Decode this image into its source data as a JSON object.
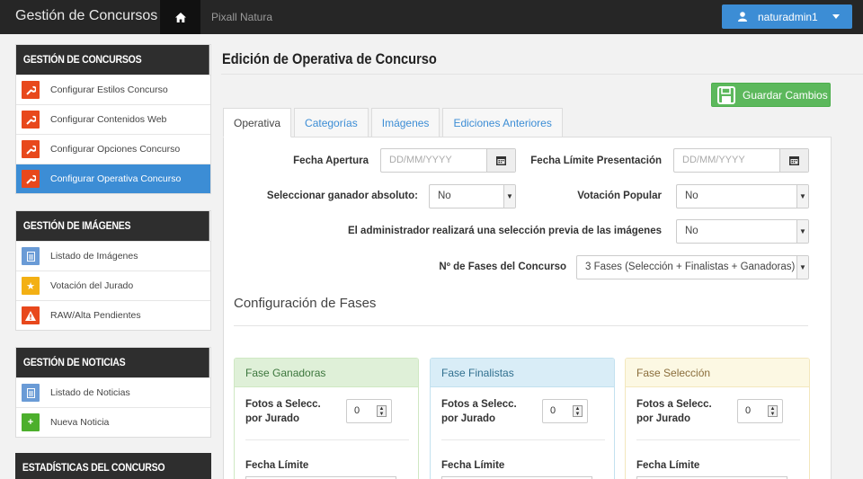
{
  "app": {
    "brand": "Gestión de Concursos",
    "app_name": "Pixall Natura",
    "user": "naturadmin1"
  },
  "sidebar": {
    "sections": [
      {
        "title": "Gestión de Concursos",
        "items": [
          {
            "label": "Configurar Estilos Concurso",
            "icon": "wrench-icon"
          },
          {
            "label": "Configurar Contenidos Web",
            "icon": "wrench-icon"
          },
          {
            "label": "Configurar Opciones Concurso",
            "icon": "wrench-icon"
          },
          {
            "label": "Configurar Operativa Concurso",
            "icon": "wrench-icon",
            "active": true
          }
        ]
      },
      {
        "title": "Gestión de Imágenes",
        "items": [
          {
            "label": "Listado de Imágenes",
            "icon": "document-icon"
          },
          {
            "label": "Votación del Jurado",
            "icon": "star-icon"
          },
          {
            "label": "RAW/Alta Pendientes",
            "icon": "warning-icon"
          }
        ]
      },
      {
        "title": "Gestión de Noticias",
        "items": [
          {
            "label": "Listado de Noticias",
            "icon": "document-icon"
          },
          {
            "label": "Nueva Noticia",
            "icon": "plus-icon"
          }
        ]
      },
      {
        "title": "Estadísticas del Concurso",
        "items": []
      }
    ]
  },
  "main": {
    "title": "Edición de Operativa de Concurso",
    "save_label": "Guardar Cambios",
    "tabs": [
      "Operativa",
      "Categorías",
      "Imágenes",
      "Ediciones Anteriores"
    ],
    "form": {
      "fecha_apertura_label": "Fecha Apertura",
      "fecha_apertura_placeholder": "DD/MM/YYYY",
      "fecha_limite_label": "Fecha Límite Presentación",
      "fecha_limite_placeholder": "DD/MM/YYYY",
      "ganador_label": "Seleccionar ganador absoluto:",
      "ganador_value": "No",
      "votacion_label": "Votación Popular",
      "votacion_value": "No",
      "seleccion_previa_label": "El administrador realizará una selección previa de las imágenes",
      "seleccion_previa_value": "No",
      "fases_label": "Nº de Fases del Concurso",
      "fases_value": "3 Fases (Selección + Finalistas + Ganadoras)"
    },
    "section_title": "Configuración de Fases",
    "phases": [
      {
        "title": "Fase Ganadoras",
        "fotos_label": "Fotos a Selecc. por Jurado",
        "fotos_value": "0",
        "fecha_label": "Fecha Límite"
      },
      {
        "title": "Fase Finalistas",
        "fotos_label": "Fotos a Selecc. por Jurado",
        "fotos_value": "0",
        "fecha_label": "Fecha Límite"
      },
      {
        "title": "Fase Selección",
        "fotos_label": "Fotos a Selecc. por Jurado",
        "fotos_value": "0",
        "fecha_label": "Fecha Límite"
      }
    ]
  }
}
